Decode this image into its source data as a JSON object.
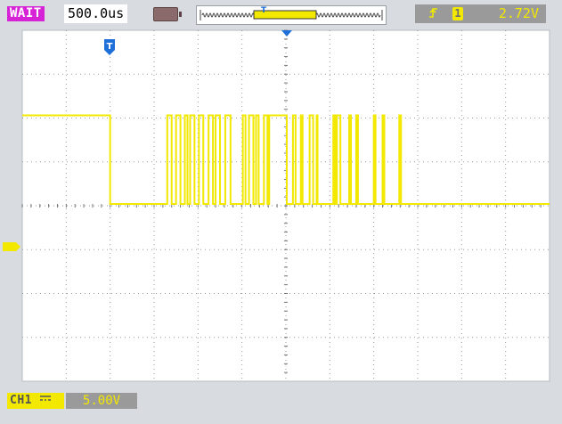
{
  "status": {
    "run_state": "WAIT",
    "timebase": "500.0us",
    "battery_icon": "battery-icon",
    "memory_bar_icon": "memory-position-icon"
  },
  "trigger": {
    "edge_icon": "rising-edge-icon",
    "source": "1",
    "level": "2.72V",
    "marker_label": "T"
  },
  "channel": {
    "name": "CH1",
    "coupling_icon": "dc-coupling-icon",
    "scale": "5.00V",
    "ground_marker_icon": "ground-level-marker-icon"
  },
  "colors": {
    "trace": "#f2e800",
    "background": "#d8dce0",
    "screen": "#ffffff",
    "grid": "#9a9a9a",
    "trigger_marker": "#1e6fd8",
    "wait_badge": "#d623d6"
  },
  "trace": {
    "levels": {
      "high": 5.0,
      "low": 0.0
    },
    "transition_times_us": [
      1000,
      1650,
      1700,
      1750,
      1800,
      1850,
      1880,
      1910,
      1960,
      2010,
      2060,
      2120,
      2170,
      2200,
      2250,
      2310,
      2370,
      2510,
      2540,
      2580,
      2630,
      2660,
      2690,
      2750,
      2790,
      2810,
      3010,
      3080,
      3110,
      3170,
      3190,
      3270,
      3310,
      3350,
      3360,
      3540,
      3560,
      3580,
      3620,
      3720,
      3740,
      3800,
      3820,
      4000,
      4020,
      4100,
      4120,
      4290,
      4310
    ],
    "time_range_us": [
      0,
      6000
    ],
    "volt_range": [
      -10,
      10
    ]
  }
}
